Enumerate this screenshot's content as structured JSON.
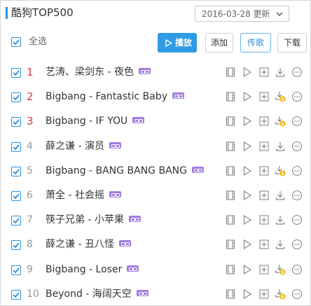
{
  "header": {
    "title": "酷狗TOP500",
    "date_label": "2016-03-28 更新"
  },
  "toolbar": {
    "select_all_label": "全选",
    "play_label": "播放",
    "add_label": "添加",
    "share_label": "传歌",
    "download_label": "下载"
  },
  "songs": [
    {
      "rank": "1",
      "title": "艺涛、梁剑东 - 夜色",
      "sq": true,
      "checked": true,
      "top": true,
      "dl_badge": false
    },
    {
      "rank": "2",
      "title": "Bigbang - Fantastic Baby",
      "sq": true,
      "checked": true,
      "top": true,
      "dl_badge": true
    },
    {
      "rank": "3",
      "title": "Bigbang - IF YOU",
      "sq": true,
      "checked": true,
      "top": true,
      "dl_badge": true
    },
    {
      "rank": "4",
      "title": "薛之谦 - 演员",
      "sq": true,
      "checked": true,
      "top": false,
      "dl_badge": false
    },
    {
      "rank": "5",
      "title": "Bigbang - BANG BANG BANG",
      "sq": true,
      "checked": true,
      "top": false,
      "dl_badge": true
    },
    {
      "rank": "6",
      "title": "萧全 - 社会摇",
      "sq": true,
      "checked": true,
      "top": false,
      "dl_badge": false
    },
    {
      "rank": "7",
      "title": "筷子兄弟 - 小苹果",
      "sq": true,
      "checked": true,
      "top": false,
      "dl_badge": false
    },
    {
      "rank": "8",
      "title": "薛之谦 - 丑八怪",
      "sq": true,
      "checked": true,
      "top": false,
      "dl_badge": false
    },
    {
      "rank": "9",
      "title": "Bigbang - Loser",
      "sq": true,
      "checked": true,
      "top": false,
      "dl_badge": true
    },
    {
      "rank": "10",
      "title": "Beyond - 海阔天空",
      "sq": true,
      "checked": true,
      "top": false,
      "dl_badge": true
    }
  ],
  "colors": {
    "accent": "#2a90e0",
    "play_button": "#2f9be6",
    "rank_top": "#e2344a",
    "sq_badge": "#a37be0",
    "download_badge": "#f0b400"
  },
  "icons": {
    "row_actions": [
      "mv-icon",
      "play-icon",
      "add-icon",
      "download-icon",
      "more-icon"
    ]
  }
}
